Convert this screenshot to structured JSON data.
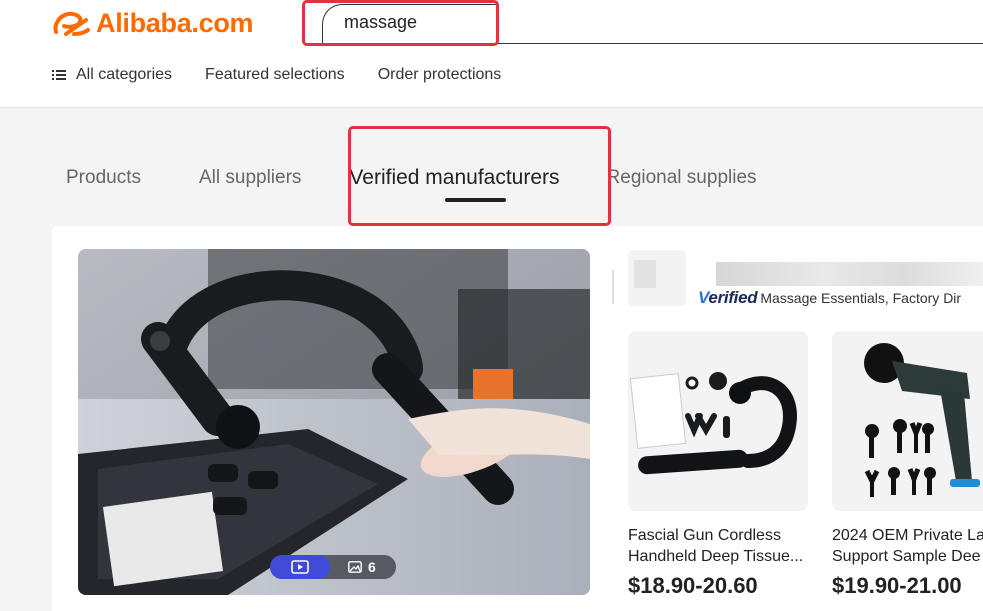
{
  "header": {
    "logo_text": "Alibaba.com",
    "search_value": "massage",
    "brand_color": "#ff6a00",
    "highlight_color": "#e0333f"
  },
  "nav": {
    "items": [
      {
        "label": "All categories",
        "icon": "menu-icon"
      },
      {
        "label": "Featured selections"
      },
      {
        "label": "Order protections"
      }
    ]
  },
  "tabs": [
    {
      "label": "Products",
      "active": false
    },
    {
      "label": "All suppliers",
      "active": false
    },
    {
      "label": "Verified manufacturers",
      "active": true
    },
    {
      "label": "Regional supplies",
      "active": false
    }
  ],
  "main_media": {
    "video_icon": "video-icon",
    "image_icon": "image-icon",
    "image_count": "6"
  },
  "supplier": {
    "verified_label_prefix": "V",
    "verified_label_rest": "erified",
    "description": "Massage Essentials, Factory Dir"
  },
  "products": [
    {
      "title_line1": "Fascial Gun Cordless",
      "title_line2": "Handheld Deep Tissue...",
      "price": "$18.90-20.60"
    },
    {
      "title_line1": "2024 OEM Private La",
      "title_line2": "Support Sample Dee",
      "price": "$19.90-21.00"
    }
  ]
}
